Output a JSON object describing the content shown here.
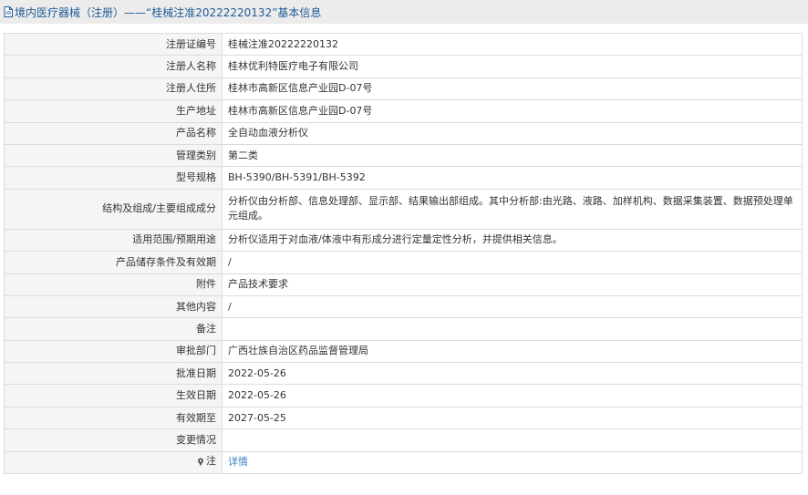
{
  "header": {
    "title": "境内医疗器械（注册）——“桂械注准20222220132”基本信息"
  },
  "rows": [
    {
      "label": "注册证编号",
      "value": "桂械注准20222220132"
    },
    {
      "label": "注册人名称",
      "value": "桂林优利特医疗电子有限公司"
    },
    {
      "label": "注册人住所",
      "value": "桂林市高新区信息产业园D-07号"
    },
    {
      "label": "生产地址",
      "value": "桂林市高新区信息产业园D-07号"
    },
    {
      "label": "产品名称",
      "value": "全自动血液分析仪"
    },
    {
      "label": "管理类别",
      "value": "第二类"
    },
    {
      "label": "型号规格",
      "value": "BH-5390/BH-5391/BH-5392"
    },
    {
      "label": "结构及组成/主要组成成分",
      "value": "分析仪由分析部、信息处理部、显示部、结果输出部组成。其中分析部:由光路、液路、加样机构、数据采集装置、数据预处理单元组成。"
    },
    {
      "label": "适用范围/预期用途",
      "value": "分析仪适用于对血液/体液中有形成分进行定量定性分析，并提供相关信息。"
    },
    {
      "label": "产品储存条件及有效期",
      "value": "/"
    },
    {
      "label": "附件",
      "value": "产品技术要求"
    },
    {
      "label": "其他内容",
      "value": "/"
    },
    {
      "label": "备注",
      "value": ""
    },
    {
      "label": "审批部门",
      "value": "广西壮族自治区药品监督管理局"
    },
    {
      "label": "批准日期",
      "value": "2022-05-26"
    },
    {
      "label": "生效日期",
      "value": "2022-05-26"
    },
    {
      "label": "有效期至",
      "value": "2027-05-25"
    },
    {
      "label": "变更情况",
      "value": ""
    }
  ],
  "note": {
    "label": "注",
    "link": "详情"
  },
  "icons": {
    "header": "document-icon",
    "note": "pin-icon"
  },
  "colors": {
    "header_bg": "#ececec",
    "title": "#1f5a96",
    "link": "#3a7fc1",
    "label_bg": "#f5f5f5",
    "border": "#dcdcdc"
  }
}
